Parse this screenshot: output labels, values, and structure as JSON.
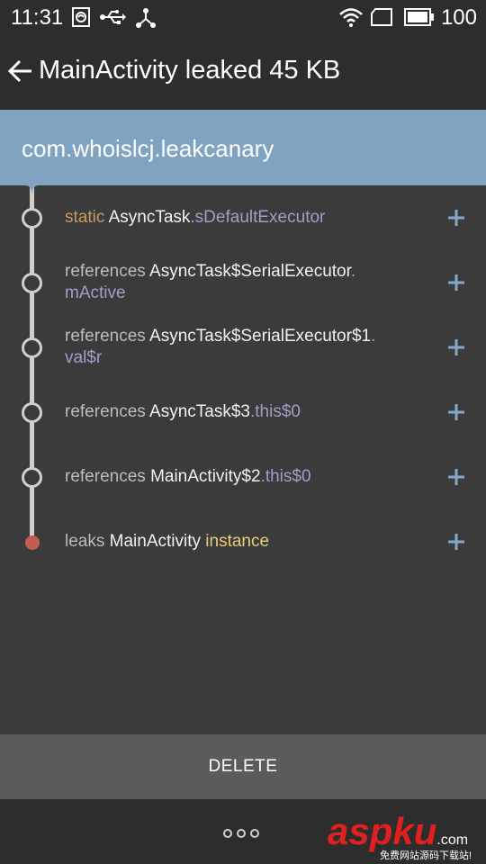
{
  "status_bar": {
    "time": "11:31",
    "battery": "100"
  },
  "toolbar": {
    "title": "MainActivity leaked 45 KB"
  },
  "header": {
    "package": "com.whoislcj.leakcanary"
  },
  "trace": [
    {
      "prefix": "static",
      "class_name": "AsyncTask",
      "field": ".sDefaultExecutor",
      "field2": ""
    },
    {
      "prefix": "references",
      "class_name": "AsyncTask$SerialExecutor",
      "field": ".",
      "field2": "mActive"
    },
    {
      "prefix": "references",
      "class_name": "AsyncTask$SerialExecutor$1",
      "field": ".",
      "field2": "val$r"
    },
    {
      "prefix": "references",
      "class_name": "AsyncTask$3",
      "field": ".this$0",
      "field2": ""
    },
    {
      "prefix": "references",
      "class_name": "MainActivity$2",
      "field": ".this$0",
      "field2": ""
    },
    {
      "prefix": "leaks",
      "class_name": "MainActivity",
      "field": "instance",
      "field2": ""
    }
  ],
  "actions": {
    "delete_label": "DELETE"
  },
  "watermark": {
    "brand": "aspku",
    "tld": ".com",
    "slogan": "免费网站源码下载站!"
  },
  "colors": {
    "header": "#7fa3c1",
    "background": "#3b3b3b",
    "bar": "#2d2d2d",
    "delete_bar": "#5b5b5b",
    "leak_dot": "#c35b52",
    "static_keyword": "#c99b62",
    "field": "#9f9fc7",
    "instance": "#e9cd7b"
  },
  "icons": [
    "notification-icon",
    "usb-icon",
    "share-icon",
    "wifi-icon",
    "sim-icon",
    "battery-icon",
    "back-arrow-icon",
    "expand-plus-icon",
    "more-dots-icon"
  ]
}
